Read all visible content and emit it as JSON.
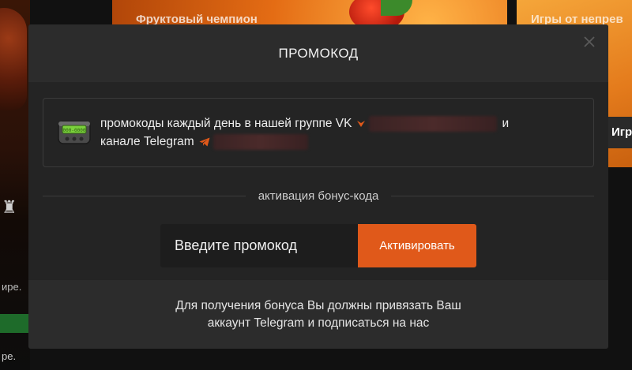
{
  "background": {
    "card_left_subtitle": "Фруктовый чемпион",
    "card_right_subtitle": "Игры от непрев",
    "play_button_label": "Игра",
    "left_fragment_1": "ире.",
    "left_fragment_2": "ре."
  },
  "modal": {
    "title": "ПРОМОКОД",
    "close_icon": "close-icon",
    "info": {
      "icon": "pager-icon",
      "line1_text": "промокоды каждый день в нашей группе VK",
      "line1_suffix": "и",
      "line2_text": "канале Telegram"
    },
    "divider_label": "активация бонус-кода",
    "promo_input": {
      "placeholder": "Введите промокод",
      "value": ""
    },
    "activate_button_label": "Активировать",
    "footer_note_line1": "Для получения бонуса Вы должны привязать Ваш",
    "footer_note_line2": "аккаунт Telegram и подписаться на нас"
  },
  "colors": {
    "accent": "#e0591a",
    "modal_bg": "#242424",
    "header_bg": "#2c2c2c"
  }
}
